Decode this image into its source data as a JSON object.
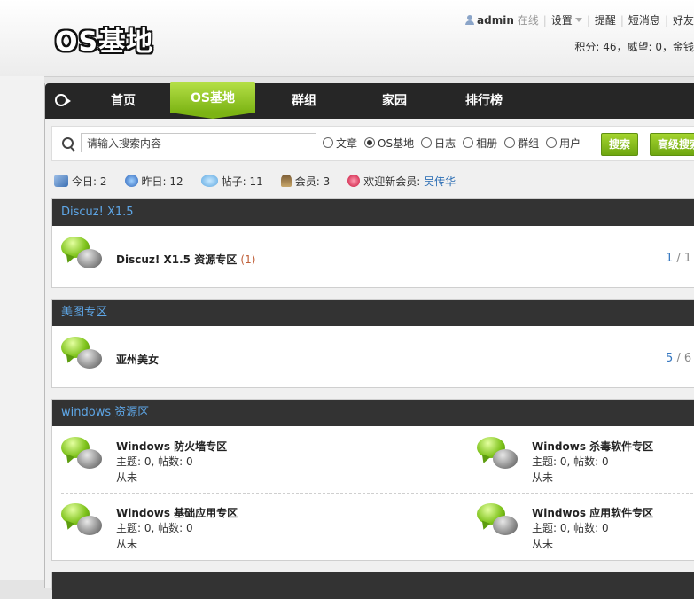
{
  "logo": "OS基地",
  "userbar": {
    "username": "admin",
    "status": "在线",
    "settings": "设置",
    "reminders": "提醒",
    "messages": "短消息",
    "friends": "好友"
  },
  "credits": "积分: 46，威望: 0，金钱",
  "nav": {
    "items": [
      "首页",
      "OS基地",
      "群组",
      "家园",
      "排行榜"
    ],
    "active": "OS基地"
  },
  "search": {
    "placeholder": "请输入搜索内容",
    "options": [
      "文章",
      "OS基地",
      "日志",
      "相册",
      "群组",
      "用户"
    ],
    "selected": "OS基地",
    "search_button": "搜索",
    "advanced_button": "高级搜索"
  },
  "stats": {
    "today": "今日: 2",
    "yesterday": "昨日: 12",
    "posts": "帖子: 11",
    "members": "会员: 3",
    "welcome": "欢迎新会员:",
    "new_member": "吴传华"
  },
  "sections": [
    {
      "title": "Discuz! X1.5",
      "forums": [
        {
          "name": "Discuz! X1.5 资源专区",
          "count": "(1)",
          "page_current": "1",
          "page_total": "/ 1"
        }
      ]
    },
    {
      "title": "美图专区",
      "forums": [
        {
          "name": "亚州美女",
          "page_current": "5",
          "page_total": "/ 6"
        }
      ]
    },
    {
      "title": "windows 资源区",
      "forums": [
        {
          "name": "Windows 防火墙专区",
          "meta": "主题: 0, 帖数: 0",
          "last": "从未"
        },
        {
          "name": "Windows 杀毒软件专区",
          "meta": "主题: 0, 帖数: 0",
          "last": "从未"
        },
        {
          "name": "Windows 基础应用专区",
          "meta": "主题: 0, 帖数: 0",
          "last": "从未"
        },
        {
          "name": "Windwos 应用软件专区",
          "meta": "主题: 0, 帖数: 0",
          "last": "从未"
        }
      ]
    }
  ]
}
